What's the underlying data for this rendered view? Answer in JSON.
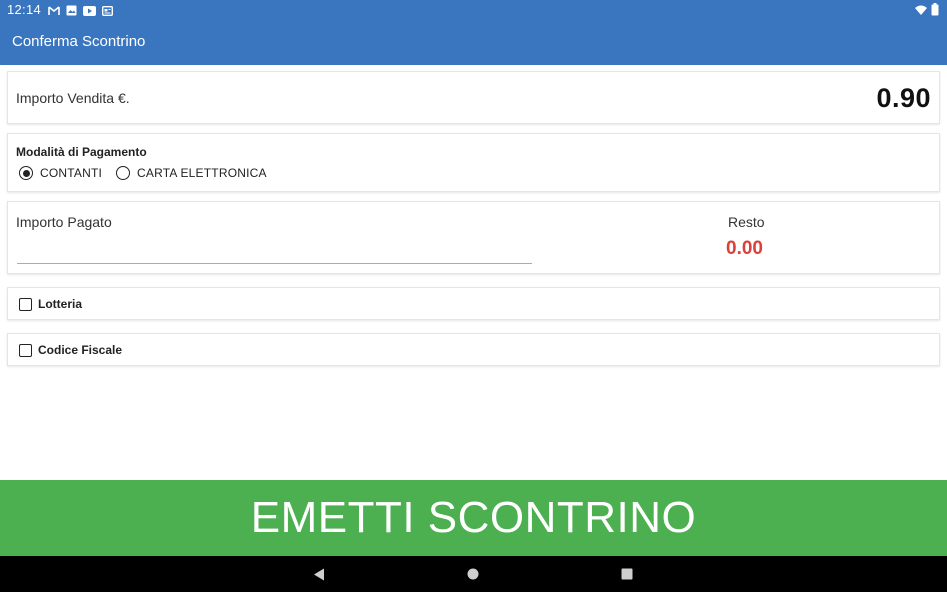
{
  "status_bar": {
    "time": "12:14",
    "left_icons": [
      "gmail-icon",
      "image-icon",
      "youtube-icon",
      "news-icon"
    ],
    "right_icons": [
      "wifi-icon",
      "battery-icon"
    ]
  },
  "app_bar": {
    "title": "Conferma Scontrino",
    "color": "#3a76bf"
  },
  "sale": {
    "label": "Importo Vendita €.",
    "value": "0.90"
  },
  "payment": {
    "title": "Modalità di Pagamento",
    "options": [
      {
        "label": "CONTANTI",
        "selected": true
      },
      {
        "label": "CARTA ELETTRONICA",
        "selected": false
      }
    ]
  },
  "amount": {
    "label": "Importo Pagato",
    "value": "",
    "change_label": "Resto",
    "change_value": "0.00",
    "change_color": "#d9413a"
  },
  "options": {
    "lotteria_label": "Lotteria",
    "lotteria_checked": false,
    "codice_fiscale_label": "Codice Fiscale",
    "codice_fiscale_checked": false
  },
  "action": {
    "emit_label": "EMETTI SCONTRINO",
    "color": "#4caf50"
  },
  "nav": {
    "icons": [
      "back-icon",
      "home-icon",
      "recents-icon"
    ]
  }
}
